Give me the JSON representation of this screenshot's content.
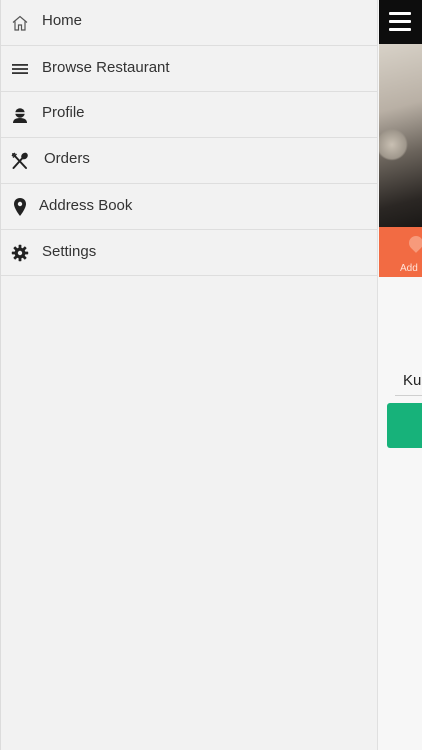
{
  "drawer": {
    "items": [
      {
        "label": "Home",
        "icon": "home-icon"
      },
      {
        "label": "Browse Restaurant",
        "icon": "menu-lines-icon"
      },
      {
        "label": "Profile",
        "icon": "user-icon"
      },
      {
        "label": "Orders",
        "icon": "fork-spoon-icon"
      },
      {
        "label": "Address Book",
        "icon": "location-pin-icon"
      },
      {
        "label": "Settings",
        "icon": "gear-icon"
      }
    ]
  },
  "app": {
    "orange_bar_label": "Add",
    "input_text": "Ku",
    "colors": {
      "topbar": "#0d0d0d",
      "accent_orange": "#f26b43",
      "accent_green": "#17b27a"
    }
  }
}
